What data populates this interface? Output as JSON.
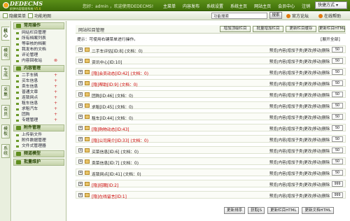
{
  "logo": {
    "main": "DEDECMS",
    "sub": "织梦内容管理系统",
    "version": "V5.6"
  },
  "welcome": "您好：admin ，欢迎使用DEDECMS!",
  "topnav": [
    "主菜单",
    "内容发布",
    "系统设置",
    "系统主页",
    "网站主页",
    "会员中心",
    "注销"
  ],
  "quick": {
    "label": "快捷方式",
    "icon": "chevron-down-icon"
  },
  "secbar": {
    "hide_menu": "隐藏菜单",
    "map": "功能地图",
    "search_placeholder": "功能搜索",
    "search_btn": "搜索",
    "site": "官方论坛",
    "help": "在线帮助"
  },
  "vtabs": [
    "核心",
    "模块",
    "生成",
    "采集",
    "会员",
    "模板",
    "系统"
  ],
  "sidebar": [
    {
      "title": "常用操作",
      "items": [
        "网站栏目管理",
        "所有档案列表",
        "等审核的档案",
        "我发布的文档",
        "评论管理",
        "内容回收站"
      ]
    },
    {
      "title": "内容管理",
      "items": [
        "二手车辆",
        "买车信息",
        "卖车信息",
        "普通文章",
        "连锁网点",
        "租车信息",
        "求租汽车",
        "团购",
        "专题管理"
      ]
    },
    {
      "title": "附件管理",
      "items": [
        "上传新文件",
        "附件数据管理",
        "文件式管理器"
      ]
    },
    {
      "title": "频道模型",
      "items": []
    },
    {
      "title": "批量维护",
      "items": []
    }
  ],
  "main": {
    "title": "网站栏目管理",
    "buttons": [
      "增加顶级栏目",
      "批量增加栏目",
      "更新栏目缓存",
      "更新栏目HTML"
    ],
    "tip": "提示：可使用右键菜单进行操作。",
    "expand": "[展开全部]",
    "rows": [
      {
        "name": "二手车评估[ID:8] (文档：0)",
        "hidden": false,
        "ops": "预览|内容|增加子类|更改|移动|删除",
        "sort": "50"
      },
      {
        "name": "资讯中心[ID:10]",
        "hidden": false,
        "ops": "预览|内容|增加子类|更改|移动|删除",
        "sort": "50"
      },
      {
        "name": "[隐]会员动态[ID:42] (文档：0)",
        "hidden": true,
        "ops": "预览|内容|增加子类|更改|移动|删除",
        "sort": "50"
      },
      {
        "name": "[隐]帮助[ID:9] (文档：0)",
        "hidden": true,
        "ops": "预览|内容|增加子类|更改|移动|删除",
        "sort": "50"
      },
      {
        "name": "团购[ID:46] (文档：0)",
        "hidden": false,
        "ops": "预览|内容|增加子类|更改|移动|删除",
        "sort": "50"
      },
      {
        "name": "求租[ID:45] (文档：0)",
        "hidden": false,
        "ops": "预览|内容|增加子类|更改|移动|删除",
        "sort": "50"
      },
      {
        "name": "租车[ID:44] (文档：0)",
        "hidden": false,
        "ops": "预览|内容|增加子类|更改|移动|删除",
        "sort": "50"
      },
      {
        "name": "[隐]购物动态[ID:43]",
        "hidden": true,
        "ops": "预览|内容|增加子类|更改|移动|删除",
        "sort": "50"
      },
      {
        "name": "[隐]公司简介[ID:33] (文档：0)",
        "hidden": true,
        "ops": "预览|内容|增加子类|更改|移动|删除",
        "sort": "50"
      },
      {
        "name": "买菜信息[ID:6] (文档：0)",
        "hidden": false,
        "ops": "预览|内容|增加子类|更改|移动|删除",
        "sort": "50"
      },
      {
        "name": "卖菜信息[ID:7] (文档：0)",
        "hidden": false,
        "ops": "预览|内容|增加子类|更改|移动|删除",
        "sort": "50"
      },
      {
        "name": "连锁网点[ID:41] (文档：0)",
        "hidden": false,
        "ops": "预览|内容|增加子类|更改|移动|删除",
        "sort": "50"
      },
      {
        "name": "[隐]招聘[ID:2]",
        "hidden": true,
        "ops": "预览|内容|增加子类|更改|移动|删除",
        "sort": "999"
      },
      {
        "name": "[隐]在线留言[ID:1]",
        "hidden": true,
        "ops": "预览|内容|增加子类|更改|移动|删除",
        "sort": "999"
      }
    ],
    "footer": [
      "更新排序",
      "获取JS",
      "更新栏目HTML",
      "更新文档HTML"
    ]
  },
  "colors": {
    "topbar": "#4a7c10",
    "accent": "#6c9a2a",
    "hidden": "#c00000"
  }
}
